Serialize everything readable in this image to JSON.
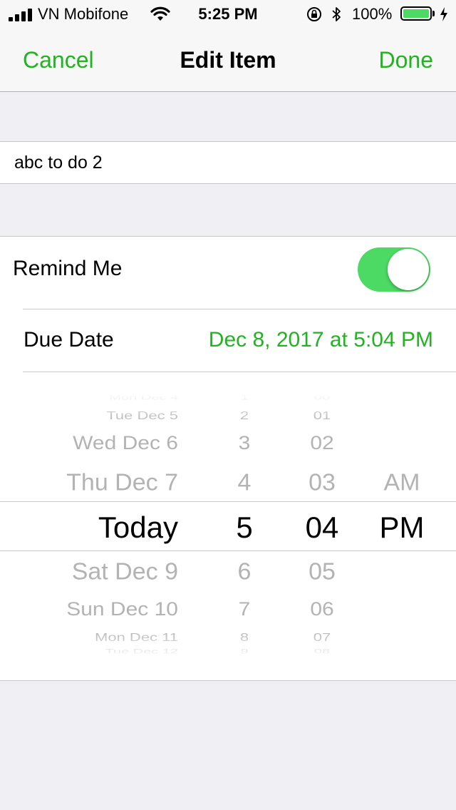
{
  "status_bar": {
    "carrier": "VN Mobifone",
    "time": "5:25 PM",
    "battery_percent": "100%",
    "battery_level": 1.0,
    "battery_color": "#4cd964"
  },
  "nav": {
    "cancel_label": "Cancel",
    "title": "Edit Item",
    "done_label": "Done",
    "accent_color": "#21b321"
  },
  "item": {
    "text_value": "abc to do 2"
  },
  "settings": {
    "remind_label": "Remind Me",
    "remind_on": true,
    "due_label": "Due Date",
    "due_value": "Dec 8, 2017 at 5:04 PM"
  },
  "picker": {
    "days": [
      "Mon Dec 4",
      "Tue Dec 5",
      "Wed Dec 6",
      "Thu Dec 7",
      "Today",
      "Sat Dec 9",
      "Sun Dec 10",
      "Mon Dec 11",
      "Tue Dec 12"
    ],
    "hours": [
      "1",
      "2",
      "3",
      "4",
      "5",
      "6",
      "7",
      "8",
      "9"
    ],
    "minutes": [
      "00",
      "01",
      "02",
      "03",
      "04",
      "05",
      "06",
      "07",
      "08"
    ],
    "ampm": [
      "AM",
      "PM"
    ],
    "selected_index": 4,
    "selected_ampm_index": 1
  }
}
